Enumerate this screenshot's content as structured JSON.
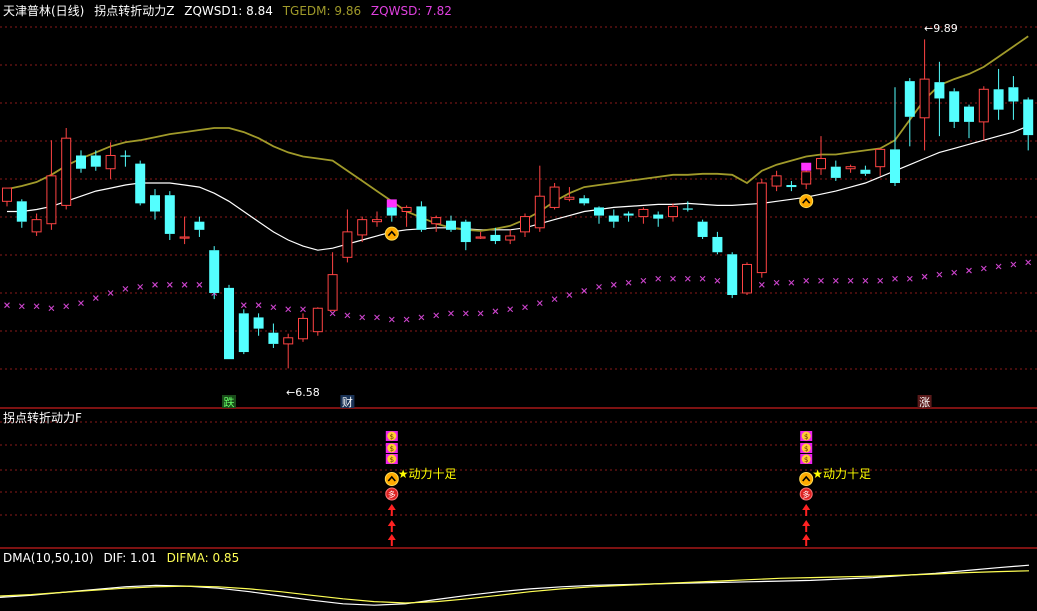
{
  "header": {
    "stock": "天津普林(日线)",
    "indicator": "拐点转折动力Z",
    "zqwsd1": "ZQWSD1: 8.84",
    "tgedm": "TGEDM: 9.86",
    "zqwsd": "ZQWSD: 7.82"
  },
  "sub_panel": {
    "title": "拐点转折动力F"
  },
  "dma_panel": {
    "title": "DMA(10,50,10)",
    "dif": "DIF: 1.01",
    "difma": "DIFMA: 0.85"
  },
  "annotations": {
    "high_label": "9.89",
    "low_label": "6.58",
    "marker_die": "跌",
    "marker_cai": "财",
    "marker_zhang": "涨",
    "signal_text": "★动力十足"
  },
  "colors": {
    "background": "#000000",
    "up": "#ff4444",
    "down": "#54ffff",
    "ma": "#ffffff",
    "band": "#a09a2a",
    "cross": "#cc44cc",
    "grid": "#8a1a1a",
    "divider": "#c81e1e",
    "signal_text": "#ffff00",
    "dif": "#ffffff",
    "difma": "#ffff55"
  },
  "chart_data": {
    "type": "candlestick",
    "ylim": [
      6.3,
      10.1
    ],
    "candles": [
      [
        8.3,
        8.43,
        8.25,
        8.28
      ],
      [
        8.3,
        8.1,
        8.04,
        8.32
      ],
      [
        8.0,
        8.12,
        7.96,
        8.18
      ],
      [
        8.08,
        8.55,
        8.02,
        8.9
      ],
      [
        8.26,
        8.92,
        8.22,
        9.02
      ],
      [
        8.75,
        8.62,
        8.58,
        8.8
      ],
      [
        8.75,
        8.64,
        8.6,
        8.8
      ],
      [
        8.62,
        8.75,
        8.52,
        8.88
      ],
      [
        8.75,
        8.74,
        8.64,
        8.8
      ],
      [
        8.67,
        8.28,
        8.26,
        8.7
      ],
      [
        8.36,
        8.2,
        8.12,
        8.42
      ],
      [
        8.36,
        7.98,
        7.92,
        8.4
      ],
      [
        7.95,
        7.95,
        7.88,
        8.15
      ],
      [
        8.1,
        8.02,
        7.95,
        8.15
      ],
      [
        7.82,
        7.4,
        7.34,
        7.86
      ],
      [
        7.45,
        6.75,
        6.75,
        7.48
      ],
      [
        7.2,
        6.82,
        6.8,
        7.24
      ],
      [
        7.16,
        7.05,
        6.98,
        7.2
      ],
      [
        7.01,
        6.9,
        6.86,
        7.1
      ],
      [
        6.9,
        6.96,
        6.66,
        7.0
      ],
      [
        6.95,
        7.15,
        6.92,
        7.2
      ],
      [
        7.02,
        7.25,
        6.98,
        7.26
      ],
      [
        7.23,
        7.58,
        7.23,
        7.8
      ],
      [
        7.75,
        8.0,
        7.7,
        8.22
      ],
      [
        7.97,
        8.12,
        7.9,
        8.15
      ],
      [
        8.1,
        8.12,
        8.05,
        8.2
      ],
      [
        8.24,
        8.16,
        8.1,
        8.26
      ],
      [
        8.2,
        8.24,
        8.05,
        8.26
      ],
      [
        8.25,
        8.02,
        8.0,
        8.3
      ],
      [
        8.08,
        8.14,
        8.0,
        8.16
      ],
      [
        8.11,
        8.02,
        8.0,
        8.16
      ],
      [
        8.1,
        7.9,
        7.82,
        8.12
      ],
      [
        7.95,
        7.95,
        7.93,
        8.0
      ],
      [
        7.97,
        7.91,
        7.88,
        8.04
      ],
      [
        7.92,
        7.96,
        7.88,
        8.02
      ],
      [
        8.0,
        8.15,
        7.95,
        8.18
      ],
      [
        8.04,
        8.35,
        8.0,
        8.65
      ],
      [
        8.24,
        8.44,
        8.22,
        8.48
      ],
      [
        8.32,
        8.34,
        8.3,
        8.44
      ],
      [
        8.33,
        8.28,
        8.26,
        8.36
      ],
      [
        8.24,
        8.16,
        8.08,
        8.25
      ],
      [
        8.16,
        8.1,
        8.04,
        8.22
      ],
      [
        8.18,
        8.16,
        8.1,
        8.2
      ],
      [
        8.15,
        8.22,
        8.08,
        8.24
      ],
      [
        8.17,
        8.13,
        8.05,
        8.2
      ],
      [
        8.15,
        8.25,
        8.1,
        8.28
      ],
      [
        8.23,
        8.22,
        8.2,
        8.3
      ],
      [
        8.1,
        7.95,
        7.93,
        8.12
      ],
      [
        7.95,
        7.8,
        7.78,
        8.0
      ],
      [
        7.78,
        7.38,
        7.35,
        7.8
      ],
      [
        7.4,
        7.68,
        7.38,
        7.7
      ],
      [
        7.6,
        8.48,
        7.55,
        8.52
      ],
      [
        8.45,
        8.55,
        8.4,
        8.6
      ],
      [
        8.46,
        8.44,
        8.4,
        8.5
      ],
      [
        8.47,
        8.59,
        8.42,
        8.62
      ],
      [
        8.62,
        8.72,
        8.56,
        8.94
      ],
      [
        8.64,
        8.53,
        8.5,
        8.7
      ],
      [
        8.62,
        8.64,
        8.58,
        8.66
      ],
      [
        8.61,
        8.57,
        8.55,
        8.65
      ],
      [
        8.64,
        8.81,
        8.55,
        8.82
      ],
      [
        8.81,
        8.48,
        8.45,
        9.42
      ],
      [
        9.48,
        9.13,
        8.84,
        9.51
      ],
      [
        9.12,
        9.5,
        8.8,
        9.89
      ],
      [
        9.47,
        9.31,
        8.94,
        9.67
      ],
      [
        9.38,
        9.08,
        9.02,
        9.41
      ],
      [
        9.23,
        9.08,
        8.92,
        9.25
      ],
      [
        9.08,
        9.4,
        8.9,
        9.43
      ],
      [
        9.4,
        9.2,
        9.1,
        9.6
      ],
      [
        9.42,
        9.28,
        9.1,
        9.53
      ],
      [
        9.3,
        8.95,
        8.8,
        9.32
      ]
    ],
    "ma_white": [
      8.2,
      8.2,
      8.22,
      8.25,
      8.3,
      8.35,
      8.4,
      8.43,
      8.46,
      8.48,
      8.48,
      8.48,
      8.46,
      8.44,
      8.38,
      8.3,
      8.2,
      8.1,
      8.0,
      7.92,
      7.86,
      7.82,
      7.84,
      7.88,
      7.92,
      7.96,
      8.0,
      8.02,
      8.03,
      8.04,
      8.04,
      8.03,
      8.02,
      8.02,
      8.02,
      8.04,
      8.08,
      8.12,
      8.16,
      8.2,
      8.22,
      8.24,
      8.25,
      8.26,
      8.27,
      8.27,
      8.28,
      8.27,
      8.26,
      8.26,
      8.27,
      8.28,
      8.3,
      8.32,
      8.34,
      8.37,
      8.4,
      8.44,
      8.48,
      8.54,
      8.6,
      8.66,
      8.72,
      8.78,
      8.82,
      8.86,
      8.9,
      8.94,
      8.98,
      9.04
    ],
    "band_olive": [
      8.42,
      8.45,
      8.49,
      8.56,
      8.65,
      8.72,
      8.78,
      8.84,
      8.88,
      8.9,
      8.93,
      8.96,
      8.98,
      9.0,
      9.02,
      9.02,
      8.98,
      8.92,
      8.84,
      8.78,
      8.74,
      8.72,
      8.7,
      8.6,
      8.5,
      8.4,
      8.3,
      8.2,
      8.14,
      8.08,
      8.04,
      8.02,
      8.01,
      8.03,
      8.06,
      8.12,
      8.2,
      8.3,
      8.38,
      8.44,
      8.46,
      8.48,
      8.5,
      8.52,
      8.54,
      8.56,
      8.56,
      8.57,
      8.57,
      8.56,
      8.48,
      8.6,
      8.66,
      8.7,
      8.74,
      8.76,
      8.76,
      8.78,
      8.8,
      8.82,
      8.9,
      9.1,
      9.3,
      9.44,
      9.5,
      9.55,
      9.62,
      9.72,
      9.82,
      9.92
    ],
    "cross_series": [
      7.28,
      7.27,
      7.27,
      7.25,
      7.27,
      7.3,
      7.35,
      7.4,
      7.44,
      7.46,
      7.48,
      7.48,
      7.48,
      7.48,
      7.4,
      7.35,
      7.28,
      7.28,
      7.26,
      7.24,
      7.24,
      7.22,
      7.2,
      7.18,
      7.16,
      7.16,
      7.14,
      7.14,
      7.16,
      7.18,
      7.2,
      7.2,
      7.2,
      7.22,
      7.24,
      7.26,
      7.3,
      7.34,
      7.38,
      7.42,
      7.46,
      7.48,
      7.5,
      7.52,
      7.54,
      7.54,
      7.54,
      7.54,
      7.52,
      7.5,
      7.48,
      7.48,
      7.5,
      7.5,
      7.52,
      7.52,
      7.52,
      7.52,
      7.52,
      7.52,
      7.54,
      7.54,
      7.56,
      7.58,
      7.6,
      7.62,
      7.64,
      7.66,
      7.68,
      7.7
    ],
    "sub_signals": [
      26,
      54
    ],
    "dma": {
      "dif": [
        0.1,
        0.16,
        0.24,
        0.32,
        0.4,
        0.44,
        0.42,
        0.36,
        0.26,
        0.14,
        0.02,
        -0.08,
        -0.12,
        -0.08,
        0.04,
        0.16,
        0.26,
        0.34,
        0.4,
        0.44,
        0.46,
        0.48,
        0.5,
        0.52,
        0.54,
        0.56,
        0.58,
        0.62,
        0.66,
        0.72,
        0.78,
        0.86,
        0.94,
        1.01
      ],
      "difma": [
        0.14,
        0.18,
        0.24,
        0.3,
        0.36,
        0.4,
        0.42,
        0.4,
        0.34,
        0.26,
        0.16,
        0.06,
        -0.02,
        -0.06,
        -0.02,
        0.06,
        0.16,
        0.26,
        0.34,
        0.4,
        0.44,
        0.48,
        0.52,
        0.56,
        0.6,
        0.64,
        0.66,
        0.68,
        0.7,
        0.73,
        0.76,
        0.8,
        0.83,
        0.85
      ]
    }
  }
}
